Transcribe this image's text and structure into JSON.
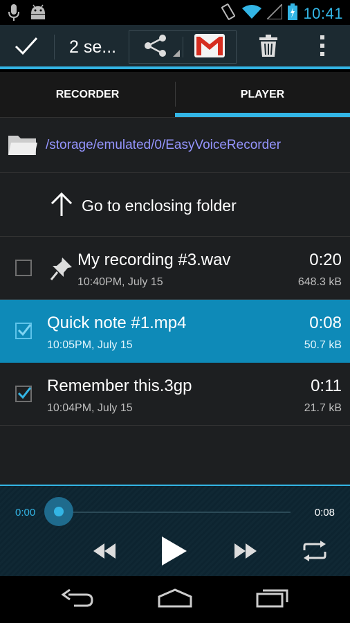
{
  "status_bar": {
    "time": "10:41",
    "left_icons": [
      "microphone-icon",
      "android-icon"
    ],
    "right_icons": [
      "vibrate-icon",
      "wifi-icon",
      "signal-icon",
      "battery-charging-icon"
    ]
  },
  "action_bar": {
    "title": "2 se...",
    "done_icon": "check-icon",
    "actions": [
      "share-icon",
      "gmail-icon",
      "trash-icon",
      "overflow-menu-icon"
    ]
  },
  "tabs": [
    {
      "label": "RECORDER",
      "active": false
    },
    {
      "label": "PLAYER",
      "active": true
    }
  ],
  "folder": {
    "path": "/storage/emulated/0/EasyVoiceRecorder",
    "up_label": "Go to enclosing folder"
  },
  "files": [
    {
      "name": "My recording #3.wav",
      "date": "10:40PM, July 15",
      "duration": "0:20",
      "size": "648.3 kB",
      "checked": false,
      "selected": false,
      "pinned": true
    },
    {
      "name": "Quick note #1.mp4",
      "date": "10:05PM, July 15",
      "duration": "0:08",
      "size": "50.7 kB",
      "checked": true,
      "selected": true,
      "pinned": false
    },
    {
      "name": "Remember this.3gp",
      "date": "10:04PM, July 15",
      "duration": "0:11",
      "size": "21.7 kB",
      "checked": true,
      "selected": false,
      "pinned": false
    }
  ],
  "player": {
    "current_time": "0:00",
    "total_time": "0:08",
    "progress": 0
  },
  "colors": {
    "accent": "#33b5e5",
    "selected_row": "#0e8ab8",
    "path_text": "#9595ff"
  }
}
